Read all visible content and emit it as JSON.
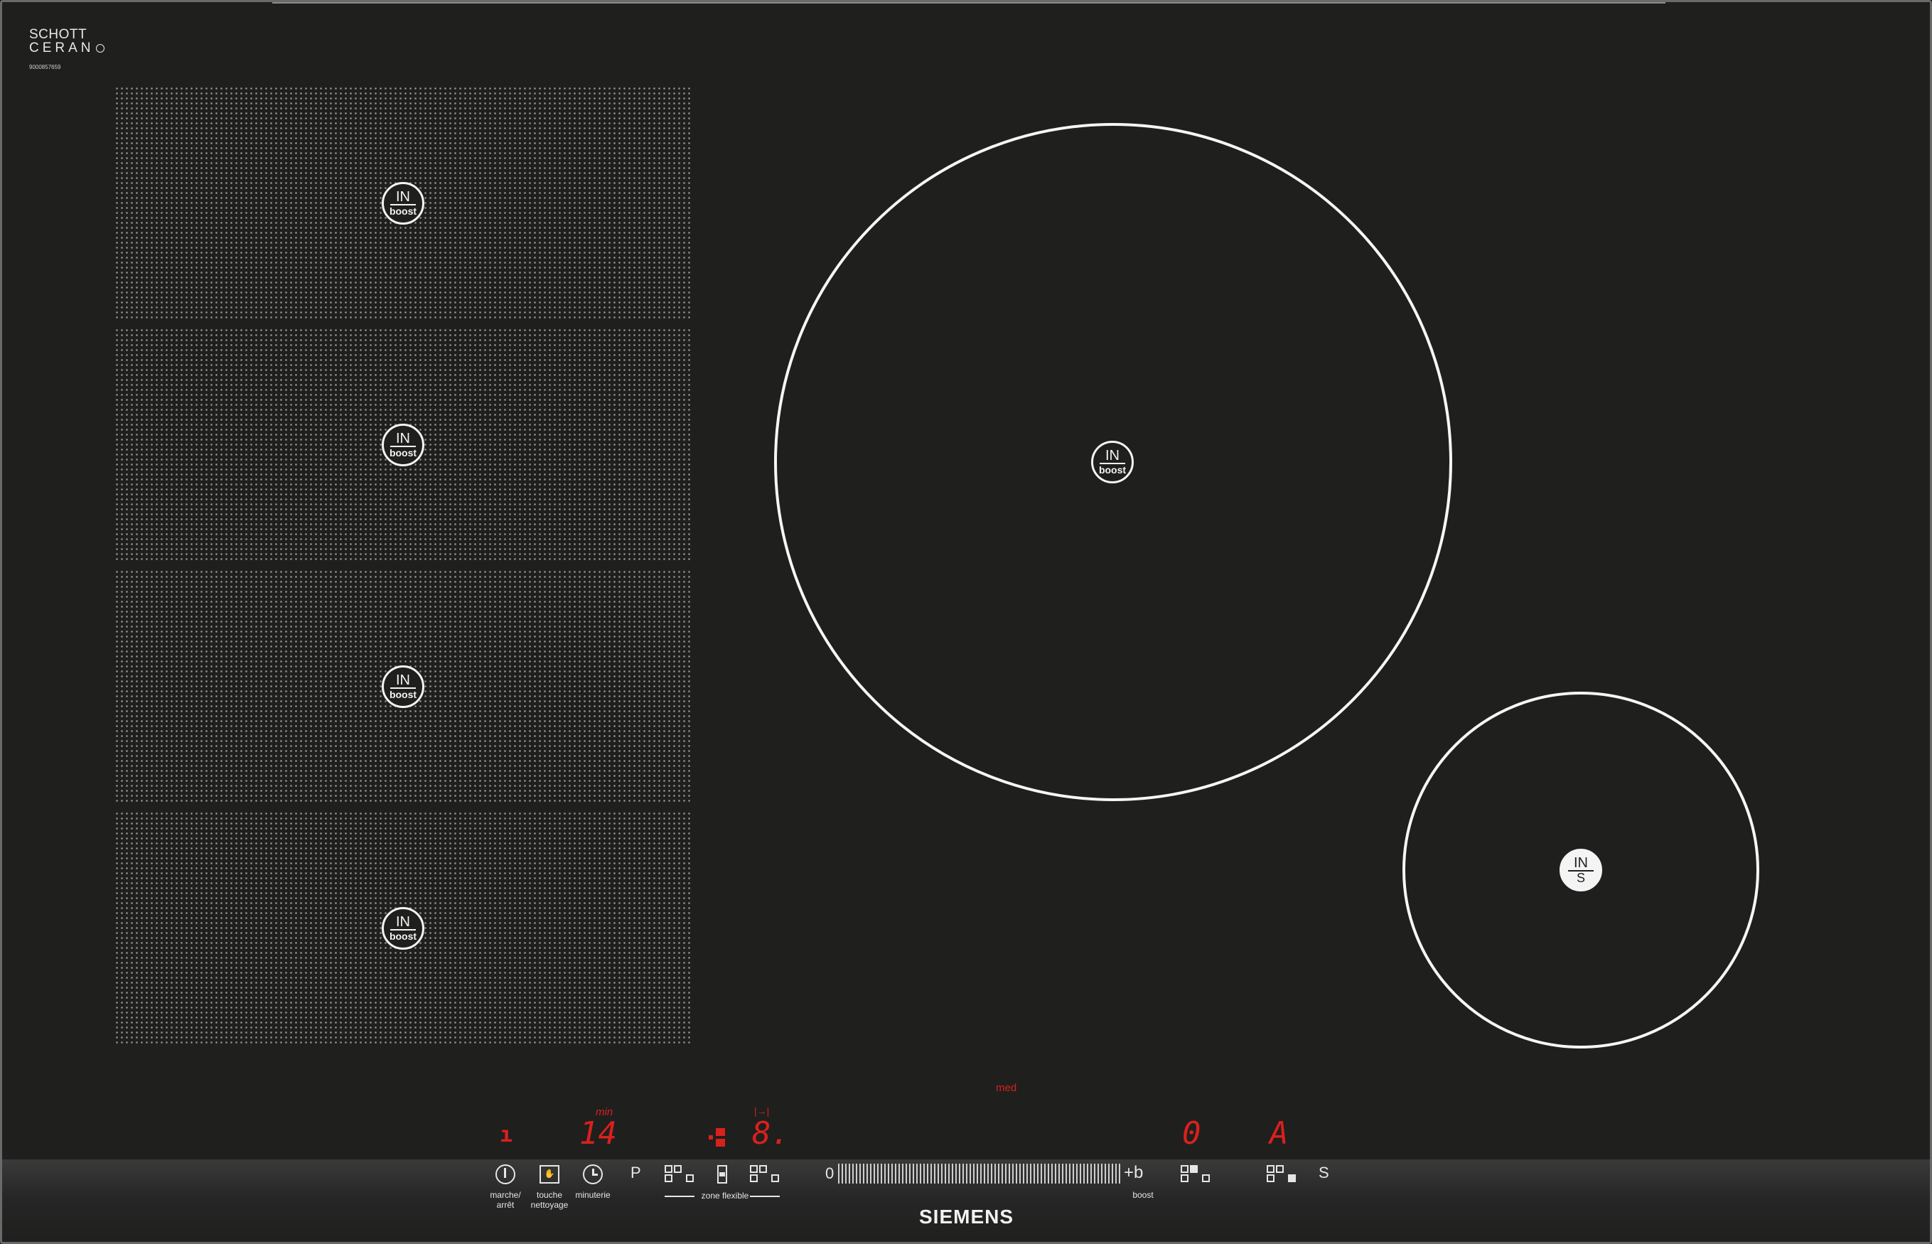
{
  "branding": {
    "glass_brand_line1": "SCHOTT",
    "glass_brand_line2": "CERAN",
    "glass_serial": "9000857659",
    "maker": "SIEMENS"
  },
  "flex_zone": {
    "sections": [
      {
        "badge_top": "IN",
        "badge_bottom": "boost"
      },
      {
        "badge_top": "IN",
        "badge_bottom": "boost"
      },
      {
        "badge_top": "IN",
        "badge_bottom": "boost"
      },
      {
        "badge_top": "IN",
        "badge_bottom": "boost"
      }
    ]
  },
  "round_zones": {
    "large": {
      "badge_top": "IN",
      "badge_bottom": "boost"
    },
    "small": {
      "badge_top": "IN",
      "badge_bottom": "S"
    }
  },
  "displays": {
    "power_indicator": "ı",
    "timer_unit": "min",
    "timer_value": "14",
    "flex_icon_label": "|→|",
    "flex_level": "8.",
    "med_label": "med",
    "zone_right_1": "0",
    "zone_right_2": "A"
  },
  "controls": {
    "on_off_label_1": "marche/",
    "on_off_label_2": "arrêt",
    "wipe_label_1": "touche",
    "wipe_label_2": "nettoyage",
    "timer_label": "minuterie",
    "p_key": "P",
    "flex_zone_label": "zone flexible",
    "slider_zero": "0",
    "boost_key": "+b",
    "boost_label": "boost",
    "s_key": "S",
    "wipe_glyph": "✋"
  },
  "colors": {
    "display_red": "#d8211d",
    "glass": "#1f1f1e"
  }
}
